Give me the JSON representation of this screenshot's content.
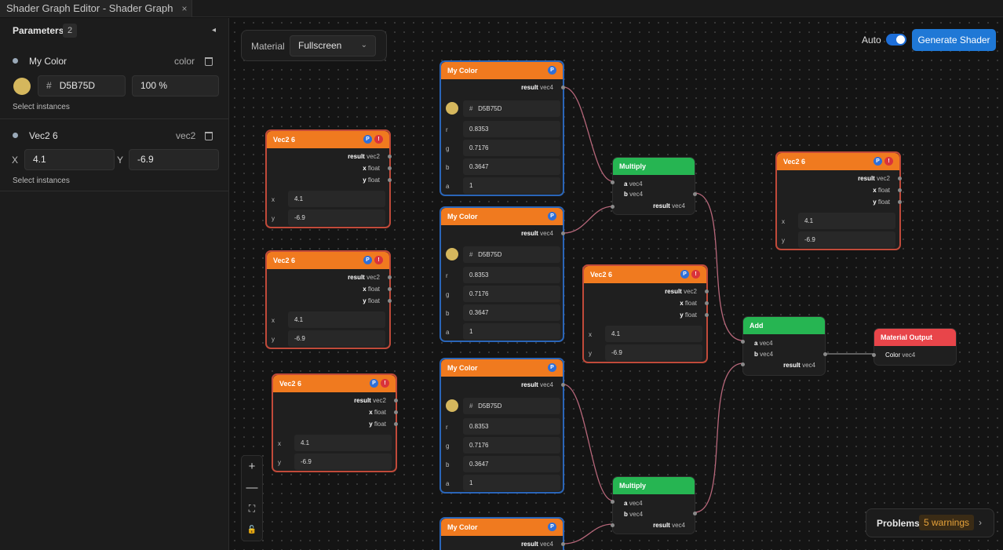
{
  "window": {
    "tab_title": "Shader Graph Editor - Shader Graph",
    "tab_close": "×"
  },
  "sidebar": {
    "title": "Parameters",
    "count": "2",
    "collapse_icon": "◂",
    "params": [
      {
        "name": "My Color",
        "type": "color",
        "hash": "#",
        "hex": "D5B75D",
        "opacity": "100 %",
        "select": "Select instances",
        "swatch": "#D5B75D"
      },
      {
        "name": "Vec2 6",
        "type": "vec2",
        "x_label": "X",
        "x": "4.1",
        "y_label": "Y",
        "y": "-6.9",
        "select": "Select instances"
      }
    ]
  },
  "toolbar": {
    "material_label": "Material",
    "material_value": "Fullscreen",
    "auto_label": "Auto",
    "auto_on": true,
    "generate": "Generate Shader"
  },
  "zoom": {
    "in": "+",
    "out": "—",
    "fit": "⛶",
    "lock": "🔓"
  },
  "problems": {
    "label": "Problems",
    "warnings": "5 warnings",
    "chevron": "›"
  },
  "nodes": {
    "color": {
      "title": "My Color",
      "badge_p": "P",
      "out": "result",
      "out_type": "vec4",
      "hash": "#",
      "hex": "D5B75D",
      "r_label": "r",
      "r": "0.8353",
      "g_label": "g",
      "g": "0.7176",
      "b_label": "b",
      "b": "0.3647",
      "a_label": "a",
      "a": "1"
    },
    "vec2": {
      "title": "Vec2 6",
      "badge_p": "P",
      "badge_e": "!",
      "result": "result",
      "result_type": "vec2",
      "x_out": "x",
      "y_out": "y",
      "float": "float",
      "x_label": "x",
      "x": "4.1",
      "y_label": "y",
      "y": "-6.9"
    },
    "multiply": {
      "title": "Multiply",
      "a": "a",
      "b": "b",
      "type": "vec4",
      "out": "result",
      "out_type": "vec4"
    },
    "add": {
      "title": "Add",
      "a": "a",
      "b": "b",
      "type": "vec4",
      "out": "result",
      "out_type": "vec4"
    },
    "output": {
      "title": "Material Output",
      "in": "Color",
      "in_type": "vec4"
    }
  },
  "colors": {
    "accent": "#1f78d6",
    "node_header": "#f07a1f",
    "math_header": "#26b552",
    "output_header": "#e8454a",
    "swatch": "#D5B75D"
  }
}
